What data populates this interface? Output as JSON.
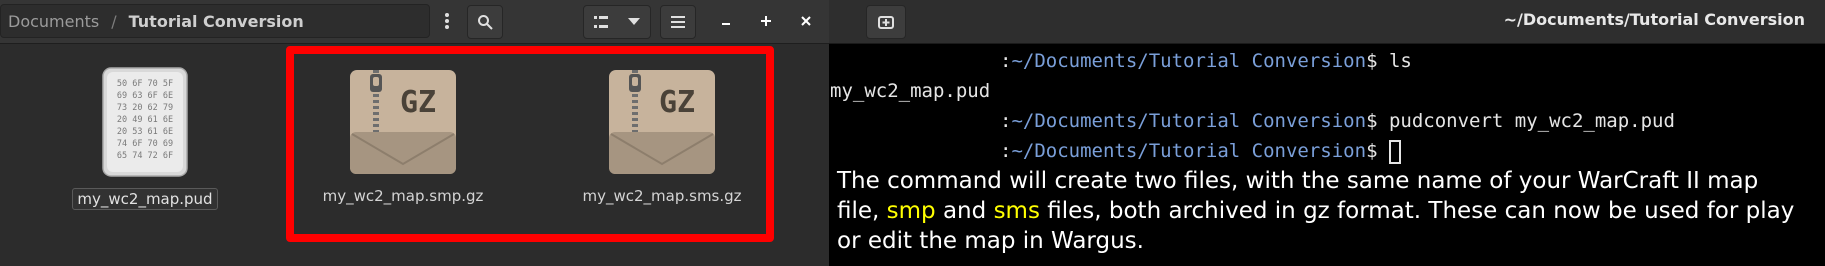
{
  "file_manager": {
    "breadcrumb": {
      "root": "Documents",
      "separator": "/",
      "current": "Tutorial Conversion"
    },
    "files": [
      {
        "name": "my_wc2_map.pud",
        "type": "hex-document",
        "hex_rows": [
          "50 6F 70 5F",
          "69 63 6F 6E",
          "73 20 62 79",
          "20 49 61 6E",
          "20 53 61 6E",
          "74 6F 70 69",
          "65 74 72 6F"
        ]
      },
      {
        "name": "my_wc2_map.smp.gz",
        "type": "gz-archive",
        "badge": "GZ"
      },
      {
        "name": "my_wc2_map.sms.gz",
        "type": "gz-archive",
        "badge": "GZ"
      }
    ],
    "highlight_color": "#ff0000"
  },
  "terminal": {
    "title": "~/Documents/Tutorial Conversion",
    "lines": [
      {
        "prompt": ":",
        "path": "~/Documents/Tutorial Conversion",
        "symbol": "$",
        "command": " ls"
      },
      {
        "output": "my_wc2_map.pud"
      },
      {
        "prompt": ":",
        "path": "~/Documents/Tutorial Conversion",
        "symbol": "$",
        "command": " pudconvert my_wc2_map.pud"
      },
      {
        "prompt": ":",
        "path": "~/Documents/Tutorial Conversion",
        "symbol": "$",
        "command": " "
      }
    ],
    "caption": {
      "part1": "The command will create two files, with the same name of your WarCraft II map file, ",
      "smp": "smp",
      "and": " and ",
      "sms": "sms",
      "part2": " files, both archived in gz format. These can now be used for play or edit the map in Wargus."
    }
  },
  "colors": {
    "path_blue": "#7a9fd9",
    "caption_highlight": "#ffff00"
  }
}
